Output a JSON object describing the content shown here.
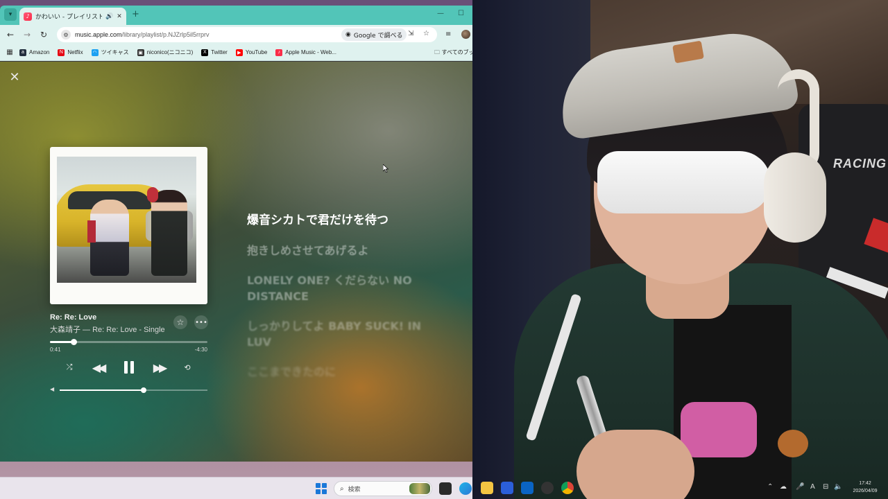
{
  "browser": {
    "tab": {
      "title": "かわいい - プレイリスト - Apple"
    },
    "address": {
      "host": "music.apple.com",
      "path": "/library/playlist/p.NJZrlp5il5rrprv"
    },
    "lens_chip": "Google で調べる",
    "bookmarks": [
      {
        "label": "Amazon",
        "icon": "amazon-icon",
        "color": "#232f3e"
      },
      {
        "label": "Netflix",
        "icon": "netflix-icon",
        "color": "#e50914"
      },
      {
        "label": "ツイキャス",
        "icon": "twitcasting-icon",
        "color": "#1da1f2"
      },
      {
        "label": "niconico(ニコニコ)",
        "icon": "niconico-icon",
        "color": "#333333"
      },
      {
        "label": "Twitter",
        "icon": "x-icon",
        "color": "#000000"
      },
      {
        "label": "YouTube",
        "icon": "youtube-icon",
        "color": "#ff0000"
      },
      {
        "label": "Apple Music - Web...",
        "icon": "apple-music-icon",
        "color": "#fa2d48"
      }
    ],
    "bookmarks_all": "すべてのブック"
  },
  "player": {
    "song_title": "Re: Re: Love",
    "song_subtitle": "大森靖子 — Re: Re: Love - Single",
    "elapsed": "0:41",
    "remaining": "-4:30",
    "progress_fraction": 0.15,
    "volume_fraction": 0.57,
    "lyrics": [
      "爆音シカトで君だけを待つ",
      "抱きしめさせてあげるよ",
      "LONELY ONE? くだらない NO DISTANCE",
      "しっかりしてよ BABY SUCK! IN LUV",
      "ここまできたのに"
    ]
  },
  "webcam": {
    "chair_brand": "RACING"
  },
  "taskbar": {
    "search_placeholder": "検索",
    "time": "17:42",
    "date": "2026/04/09",
    "ime": "A"
  },
  "colors": {
    "tabbar": "#52c5b8",
    "toolbar": "#dff2ef",
    "apple_music_red": "#fa2d48"
  }
}
